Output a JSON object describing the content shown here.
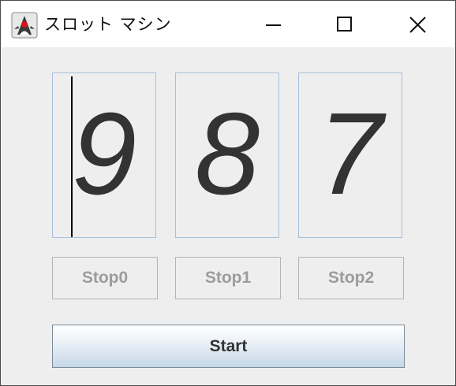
{
  "window": {
    "title": "スロット マシン",
    "app_icon": "java-duke-icon"
  },
  "titlebar_controls": [
    {
      "name": "minimize",
      "icon": "minimize-icon"
    },
    {
      "name": "maximize",
      "icon": "maximize-icon"
    },
    {
      "name": "close",
      "icon": "close-icon"
    }
  ],
  "reels": [
    {
      "value": "9"
    },
    {
      "value": "8"
    },
    {
      "value": "7"
    }
  ],
  "stop_buttons": [
    {
      "label": "Stop0",
      "enabled": false
    },
    {
      "label": "Stop1",
      "enabled": false
    },
    {
      "label": "Stop2",
      "enabled": false
    }
  ],
  "start_button": {
    "label": "Start"
  },
  "colors": {
    "window_bg": "#eeeeee",
    "reel_border": "#a9c0db",
    "digit": "#333333",
    "disabled_text": "#9c9c9c"
  }
}
